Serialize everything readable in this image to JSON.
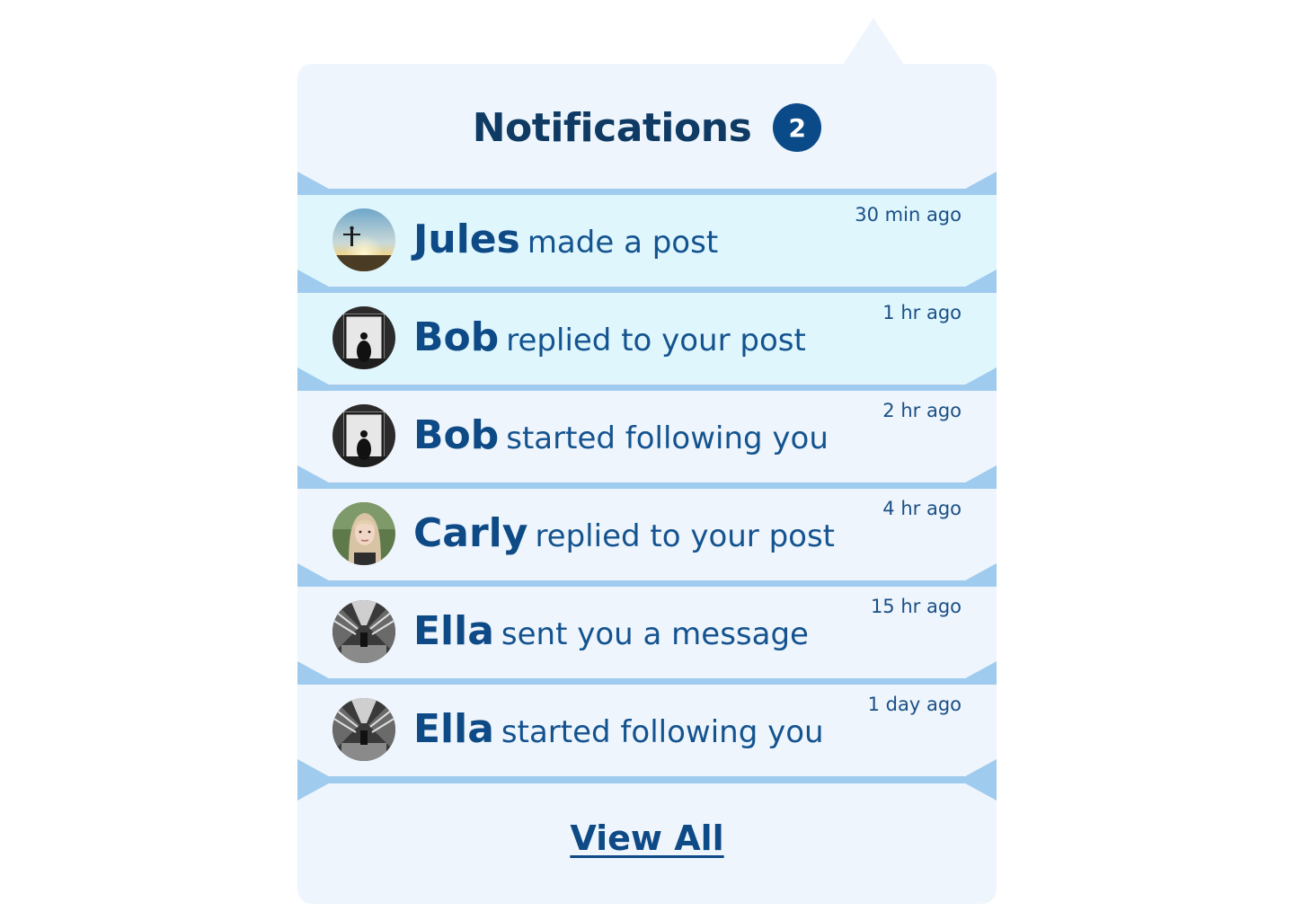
{
  "header": {
    "title": "Notifications",
    "unread_count": "2"
  },
  "notifications": [
    {
      "name": "Jules",
      "action": "made a post",
      "time": "30 min ago",
      "status": "unread",
      "avatar_icon": "person-sunset-avatar"
    },
    {
      "name": "Bob",
      "action": "replied to your post",
      "time": "1 hr ago",
      "status": "unread",
      "avatar_icon": "person-window-avatar"
    },
    {
      "name": "Bob",
      "action": "started following you",
      "time": "2 hr ago",
      "status": "read",
      "avatar_icon": "person-window-avatar"
    },
    {
      "name": "Carly",
      "action": "replied to your post",
      "time": "4 hr ago",
      "status": "read",
      "avatar_icon": "woman-portrait-avatar"
    },
    {
      "name": "Ella",
      "action": "sent you a message",
      "time": "15 hr ago",
      "status": "read",
      "avatar_icon": "city-street-avatar"
    },
    {
      "name": "Ella",
      "action": "started following you",
      "time": "1 day ago",
      "status": "read",
      "avatar_icon": "city-street-avatar"
    }
  ],
  "footer": {
    "view_all_label": "View All"
  },
  "colors": {
    "panel_bg": "#eef5fc",
    "unread_bg": "#dff6fd",
    "separator": "#9fcbee",
    "title": "#0f3a63",
    "badge": "#0b4a88",
    "name": "#0e4a86"
  }
}
